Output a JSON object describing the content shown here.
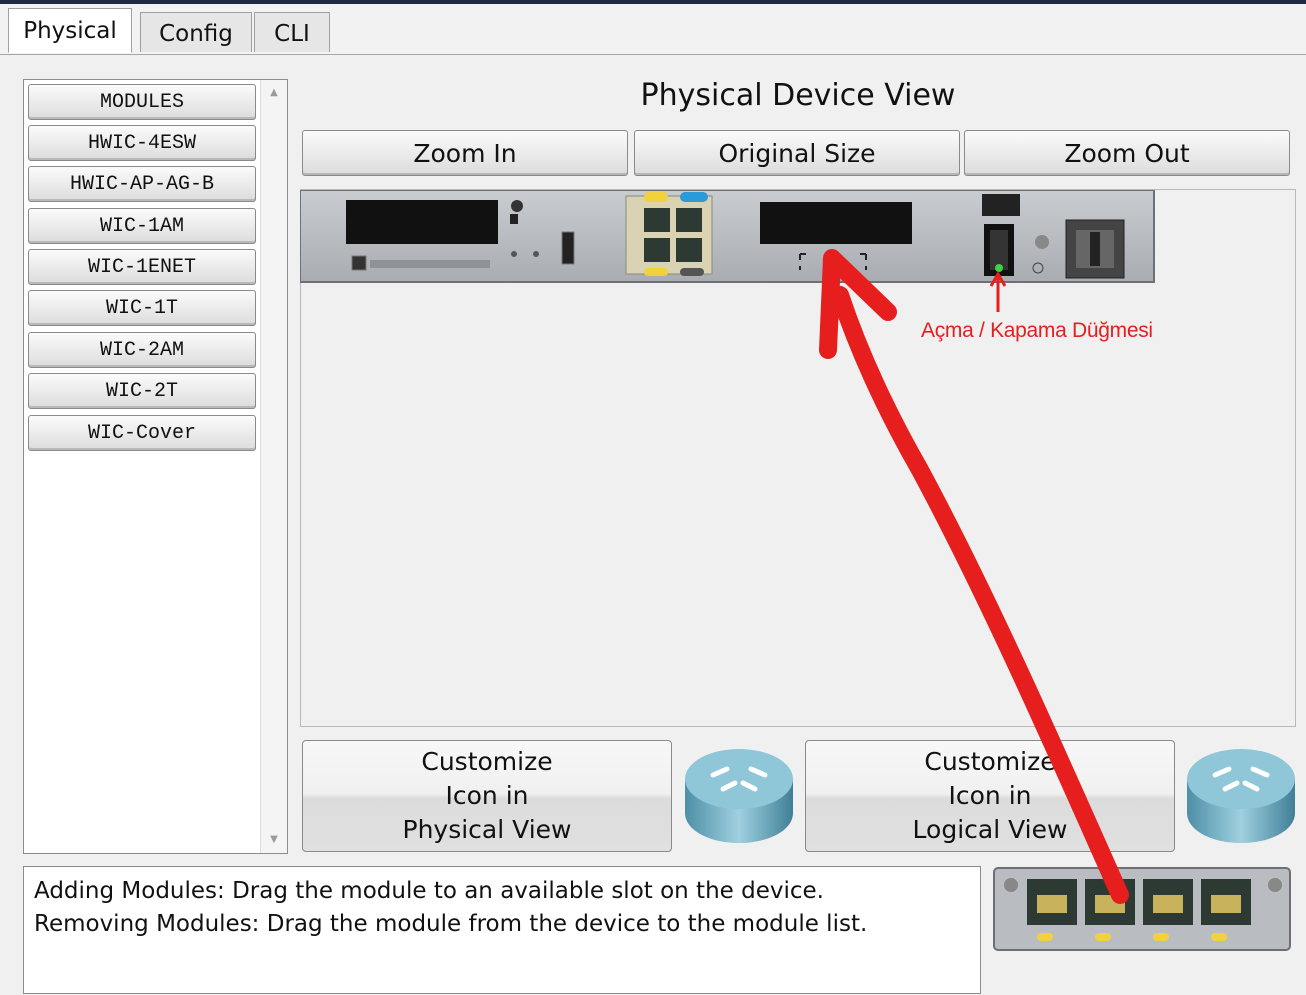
{
  "tabs": [
    {
      "label": "Physical",
      "active": true
    },
    {
      "label": "Config",
      "active": false
    },
    {
      "label": "CLI",
      "active": false
    }
  ],
  "modules": {
    "items": [
      "MODULES",
      "HWIC-4ESW",
      "HWIC-AP-AG-B",
      "WIC-1AM",
      "WIC-1ENET",
      "WIC-1T",
      "WIC-2AM",
      "WIC-2T",
      "WIC-Cover"
    ]
  },
  "device_view": {
    "title": "Physical Device View",
    "zoom_in": "Zoom In",
    "original_size": "Original Size",
    "zoom_out": "Zoom Out"
  },
  "customize_physical": {
    "line1": "Customize",
    "line2": "Icon in",
    "line3": "Physical View"
  },
  "customize_logical": {
    "line1": "Customize",
    "line2": "Icon in",
    "line3": "Logical View"
  },
  "info": {
    "line1": "Adding Modules: Drag the module to an available slot on the device.",
    "line2": "Removing Modules: Drag the module from the device to the module list."
  },
  "annotation": {
    "label": "Açma / Kapama Düğmesi",
    "color": "#e61e1e"
  },
  "icons": [
    "router-icon",
    "router-icon",
    "module-card-icon",
    "power-switch-icon"
  ]
}
